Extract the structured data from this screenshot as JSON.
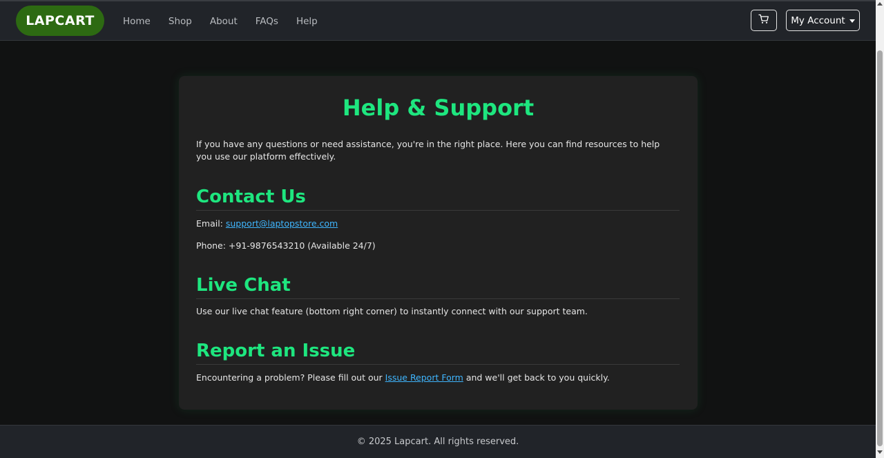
{
  "navbar": {
    "brand": "LAPCART",
    "links": [
      "Home",
      "Shop",
      "About",
      "FAQs",
      "Help"
    ],
    "cart_icon": "shopping-cart-icon",
    "account_label": "My Account"
  },
  "main": {
    "title": "Help & Support",
    "intro": "If you have any questions or need assistance, you're in the right place. Here you can find resources to help you use our platform effectively.",
    "contact": {
      "heading": "Contact Us",
      "email_label": "Email: ",
      "email": "support@laptopstore.com",
      "phone": "Phone: +91-9876543210 (Available 24/7)"
    },
    "live_chat": {
      "heading": "Live Chat",
      "text": "Use our live chat feature (bottom right corner) to instantly connect with our support team."
    },
    "report": {
      "heading": "Report an Issue",
      "text_before": "Encountering a problem? Please fill out our ",
      "link": "Issue Report Form",
      "text_after": " and we'll get back to you quickly."
    }
  },
  "footer": {
    "text": "© 2025 Lapcart. All rights reserved."
  },
  "colors": {
    "accent_green": "#1ee67f",
    "brand_green": "#2d6a12",
    "link_blue": "#3fb6ff",
    "background": "#111212",
    "card": "#212121"
  }
}
